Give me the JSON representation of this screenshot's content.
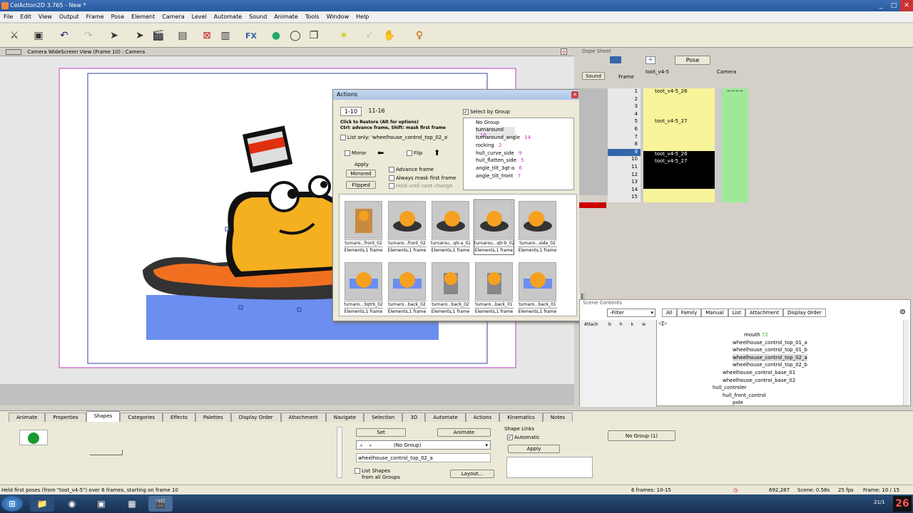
{
  "window": {
    "title": "CelAction2D 3.765 - New *",
    "min": "_",
    "max": "□",
    "close": "✕"
  },
  "menu": [
    "File",
    "Edit",
    "View",
    "Output",
    "Frame",
    "Pose",
    "Element",
    "Camera",
    "Level",
    "Automate",
    "Sound",
    "Animate",
    "Tools",
    "Window",
    "Help"
  ],
  "view": {
    "title": "Camera WideScreen View (Frame 10) : Camera"
  },
  "actions": {
    "title": "Actions",
    "tab1": "1-10",
    "tab2": "11-16",
    "hint1": "Click to Restore (Alt for options)",
    "hint2": "Ctrl: advance frame, Shift: mask first frame",
    "list_only": "List only: 'wheelhouse_control_top_02_a'",
    "mirror": "Mirror",
    "flip": "Flip",
    "apply": "Apply",
    "mirrored": "Mirrored",
    "flipped": "Flipped",
    "advance_frame": "Advance frame",
    "always_mask": "Always mask first frame",
    "hold_until": "Hold until next change",
    "select_by_group": "Select by Group",
    "groups": [
      {
        "name": "No Group",
        "count": ""
      },
      {
        "name": "turnaround",
        "count": "16"
      },
      {
        "name": "turnaround_angle",
        "count": "14"
      },
      {
        "name": "rocking",
        "count": "2"
      },
      {
        "name": "hull_curve_side",
        "count": "9"
      },
      {
        "name": "hull_flatten_side",
        "count": "5"
      },
      {
        "name": "angle_tilt_3qt-a",
        "count": "6"
      },
      {
        "name": "angle_tilt_front",
        "count": "7"
      }
    ],
    "thumbs": [
      {
        "name": "turnaro...front_02",
        "info": "Elements,1 frame"
      },
      {
        "name": "turnaro...front_02",
        "info": "Elements,1 frame"
      },
      {
        "name": "turnarou...qtr-a_02",
        "info": "Elements,1 frame"
      },
      {
        "name": "turnarou...qtr-b_02",
        "info": "Elements,1 frame"
      },
      {
        "name": "turnaro...side_02",
        "info": "Elements,1 frame"
      },
      {
        "name": "turnaro...3qtrb_02",
        "info": "Elements,1 frame"
      },
      {
        "name": "turnaro...back_02",
        "info": "Elements,1 frame"
      },
      {
        "name": "turnaro...back_02",
        "info": "Elements,1 frame"
      },
      {
        "name": "turnaro...back_01",
        "info": "Elements,1 frame"
      },
      {
        "name": "turnaro...back_01",
        "info": "Elements,1 frame"
      }
    ]
  },
  "dope": {
    "title": "Dope Sheet",
    "pose": "Pose",
    "sound": "Sound",
    "frame_label": "Frame",
    "col1": "toot_v4-5",
    "col2": "Camera",
    "rows": [
      {
        "f": "1",
        "c1": "toot_v4-5_26",
        "c2": "~~~~"
      },
      {
        "f": "2",
        "c1": "",
        "c2": ""
      },
      {
        "f": "3",
        "c1": "",
        "c2": ""
      },
      {
        "f": "4",
        "c1": "",
        "c2": ""
      },
      {
        "f": "5",
        "c1": "toot_v4-5_27",
        "c2": ""
      },
      {
        "f": "6",
        "c1": "",
        "c2": ""
      },
      {
        "f": "7",
        "c1": "",
        "c2": ""
      },
      {
        "f": "8",
        "c1": "",
        "c2": ""
      },
      {
        "f": "9",
        "c1": "",
        "c2": ""
      },
      {
        "f": "10",
        "c1": "toot_v4-5_26",
        "c2": ""
      },
      {
        "f": "11",
        "c1": "toot_v4-5_27",
        "c2": ""
      },
      {
        "f": "12",
        "c1": "",
        "c2": ""
      },
      {
        "f": "13",
        "c1": "",
        "c2": ""
      },
      {
        "f": "14",
        "c1": "",
        "c2": ""
      },
      {
        "f": "15",
        "c1": "",
        "c2": ""
      }
    ]
  },
  "scene": {
    "title": "Scene Contents",
    "filter": "-Filter",
    "tabs": [
      "All",
      "Family",
      "Manual",
      "List",
      "Attachment",
      "Display Order"
    ],
    "attach": "Attach",
    "cols": [
      "b",
      "h",
      "k",
      "w"
    ],
    "items": [
      {
        "name": "mouth",
        "count": "72"
      },
      {
        "name": "wheelhouse_control_top_01_a",
        "count": ""
      },
      {
        "name": "wheelhouse_control_top_01_b",
        "count": ""
      },
      {
        "name": "wheelhouse_control_top_02_a",
        "count": ""
      },
      {
        "name": "wheelhouse_control_top_02_b",
        "count": ""
      },
      {
        "name": "wheelhouse_control_base_01",
        "count": ""
      },
      {
        "name": "wheelhouse_control_base_02",
        "count": ""
      },
      {
        "name": "hull_controler",
        "count": ""
      },
      {
        "name": "hull_front_control",
        "count": ""
      },
      {
        "name": "pole",
        "count": ""
      }
    ]
  },
  "bottom": {
    "tabs": [
      "Animate",
      "Properties",
      "Shapes",
      "Categories",
      "Effects",
      "Palettes",
      "Display Order",
      "Attachment",
      "Navigate",
      "Selection",
      "3D",
      "Automate",
      "Actions",
      "Kinematics",
      "Notes"
    ],
    "set": "Set",
    "animate": "Animate",
    "group_select": "(No Group)",
    "shape_name": "wheelhouse_control_top_02_a",
    "list_shapes": "List Shapes",
    "from_all": "from all Groups",
    "layout": "Layout...",
    "shape_links": "Shape Links",
    "automatic": "Automatic",
    "apply": "Apply",
    "no_group": "No Group (1)"
  },
  "status": {
    "message": "Held first poses (from \"toot_v4-5\") over 6 frames, starting on frame 10",
    "frames": "6 frames: 10-15",
    "coords": "692,287",
    "scene": "Scene: 0.58s",
    "fps": "25 fps",
    "frame": "Frame: 10 / 15"
  },
  "taskbar": {
    "clock": "26",
    "time": "21/1"
  }
}
